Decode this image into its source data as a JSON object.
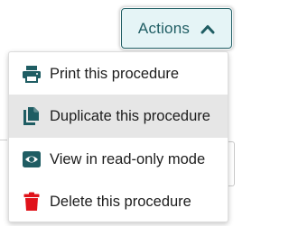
{
  "actions_button": {
    "label": "Actions",
    "icon": "chevron-up-icon",
    "expanded": true
  },
  "menu": {
    "items": [
      {
        "label": "Print this procedure",
        "icon": "printer-icon",
        "icon_color": "#1f5d63",
        "highlighted": false
      },
      {
        "label": "Duplicate this procedure",
        "icon": "copy-icon",
        "icon_color": "#1f5d63",
        "highlighted": true
      },
      {
        "label": "View in read-only mode",
        "icon": "eye-icon",
        "icon_color": "#1f5d63",
        "highlighted": false
      },
      {
        "label": "Delete this procedure",
        "icon": "trash-icon",
        "icon_color": "#e0121a",
        "highlighted": false
      }
    ]
  },
  "colors": {
    "accent": "#1f5d63",
    "button_background": "#e5f4f6",
    "highlight": "#e6e6e6",
    "danger": "#e0121a"
  }
}
